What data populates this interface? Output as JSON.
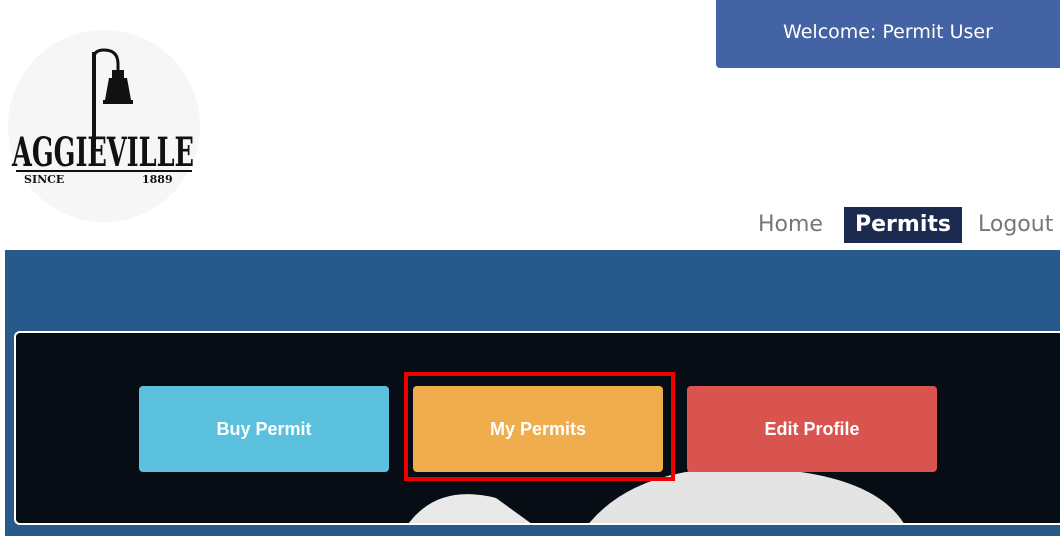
{
  "header": {
    "welcome_text": "Welcome:  Permit User"
  },
  "logo": {
    "brand_text": "AGGIEVILLE",
    "since_text": "SINCE",
    "year_text": "1889"
  },
  "nav": {
    "items": [
      {
        "label": "Home",
        "active": false
      },
      {
        "label": "Permits",
        "active": true
      },
      {
        "label": "Logout",
        "active": false
      }
    ]
  },
  "actions": {
    "buy_permit_label": "Buy Permit",
    "my_permits_label": "My Permits",
    "edit_profile_label": "Edit Profile"
  },
  "colors": {
    "welcome_bg": "#4463a4",
    "nav_active_bg": "#1b2a4e",
    "banner_bg": "#27598a",
    "panel_bg": "#070d15",
    "buy_button": "#5bc0de",
    "my_permits_button": "#f0ad4e",
    "edit_profile_button": "#d9534f",
    "highlight": "#ee0000"
  },
  "icons": {
    "logo_lamp": "street-lamp-icon"
  }
}
